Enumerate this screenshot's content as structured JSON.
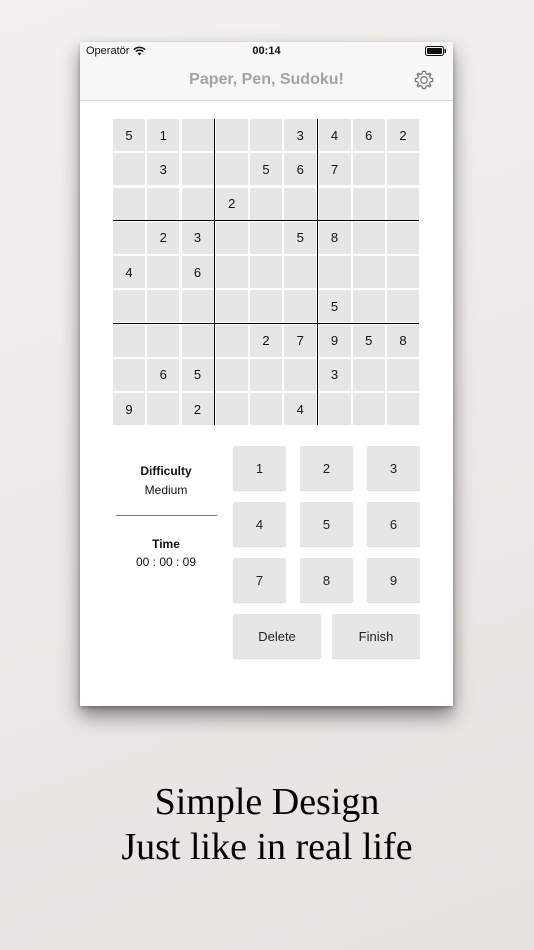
{
  "status": {
    "carrier": "Operatör",
    "time": "00:14"
  },
  "nav": {
    "title": "Paper, Pen, Sudoku!"
  },
  "grid": [
    [
      "5",
      "1",
      "",
      "",
      "",
      "3",
      "4",
      "6",
      "2"
    ],
    [
      "",
      "3",
      "",
      "",
      "5",
      "6",
      "7",
      "",
      ""
    ],
    [
      "",
      "",
      "",
      "2",
      "",
      "",
      "",
      "",
      ""
    ],
    [
      "",
      "2",
      "3",
      "",
      "",
      "5",
      "8",
      "",
      ""
    ],
    [
      "4",
      "",
      "6",
      "",
      "",
      "",
      "",
      "",
      ""
    ],
    [
      "",
      "",
      "",
      "",
      "",
      "",
      "5",
      "",
      ""
    ],
    [
      "",
      "",
      "",
      "",
      "2",
      "7",
      "9",
      "5",
      "8"
    ],
    [
      "",
      "6",
      "5",
      "",
      "",
      "",
      "3",
      "",
      ""
    ],
    [
      "9",
      "",
      "2",
      "",
      "",
      "4",
      "",
      "",
      ""
    ]
  ],
  "info": {
    "difficulty_label": "Difficulty",
    "difficulty_value": "Medium",
    "time_label": "Time",
    "time_value": "00 : 00 : 09"
  },
  "keypad": {
    "digits": [
      "1",
      "2",
      "3",
      "4",
      "5",
      "6",
      "7",
      "8",
      "9"
    ],
    "delete_label": "Delete",
    "finish_label": "Finish"
  },
  "tagline": {
    "line1": "Simple Design",
    "line2": "Just like in real life"
  },
  "colors": {
    "cell_bg": "#e6e6e6",
    "bar_bg": "#f7f7f7",
    "title_gray": "#a3a3a3"
  },
  "icons": {
    "settings": "gear-icon",
    "wifi": "wifi-icon",
    "battery": "battery-icon"
  }
}
